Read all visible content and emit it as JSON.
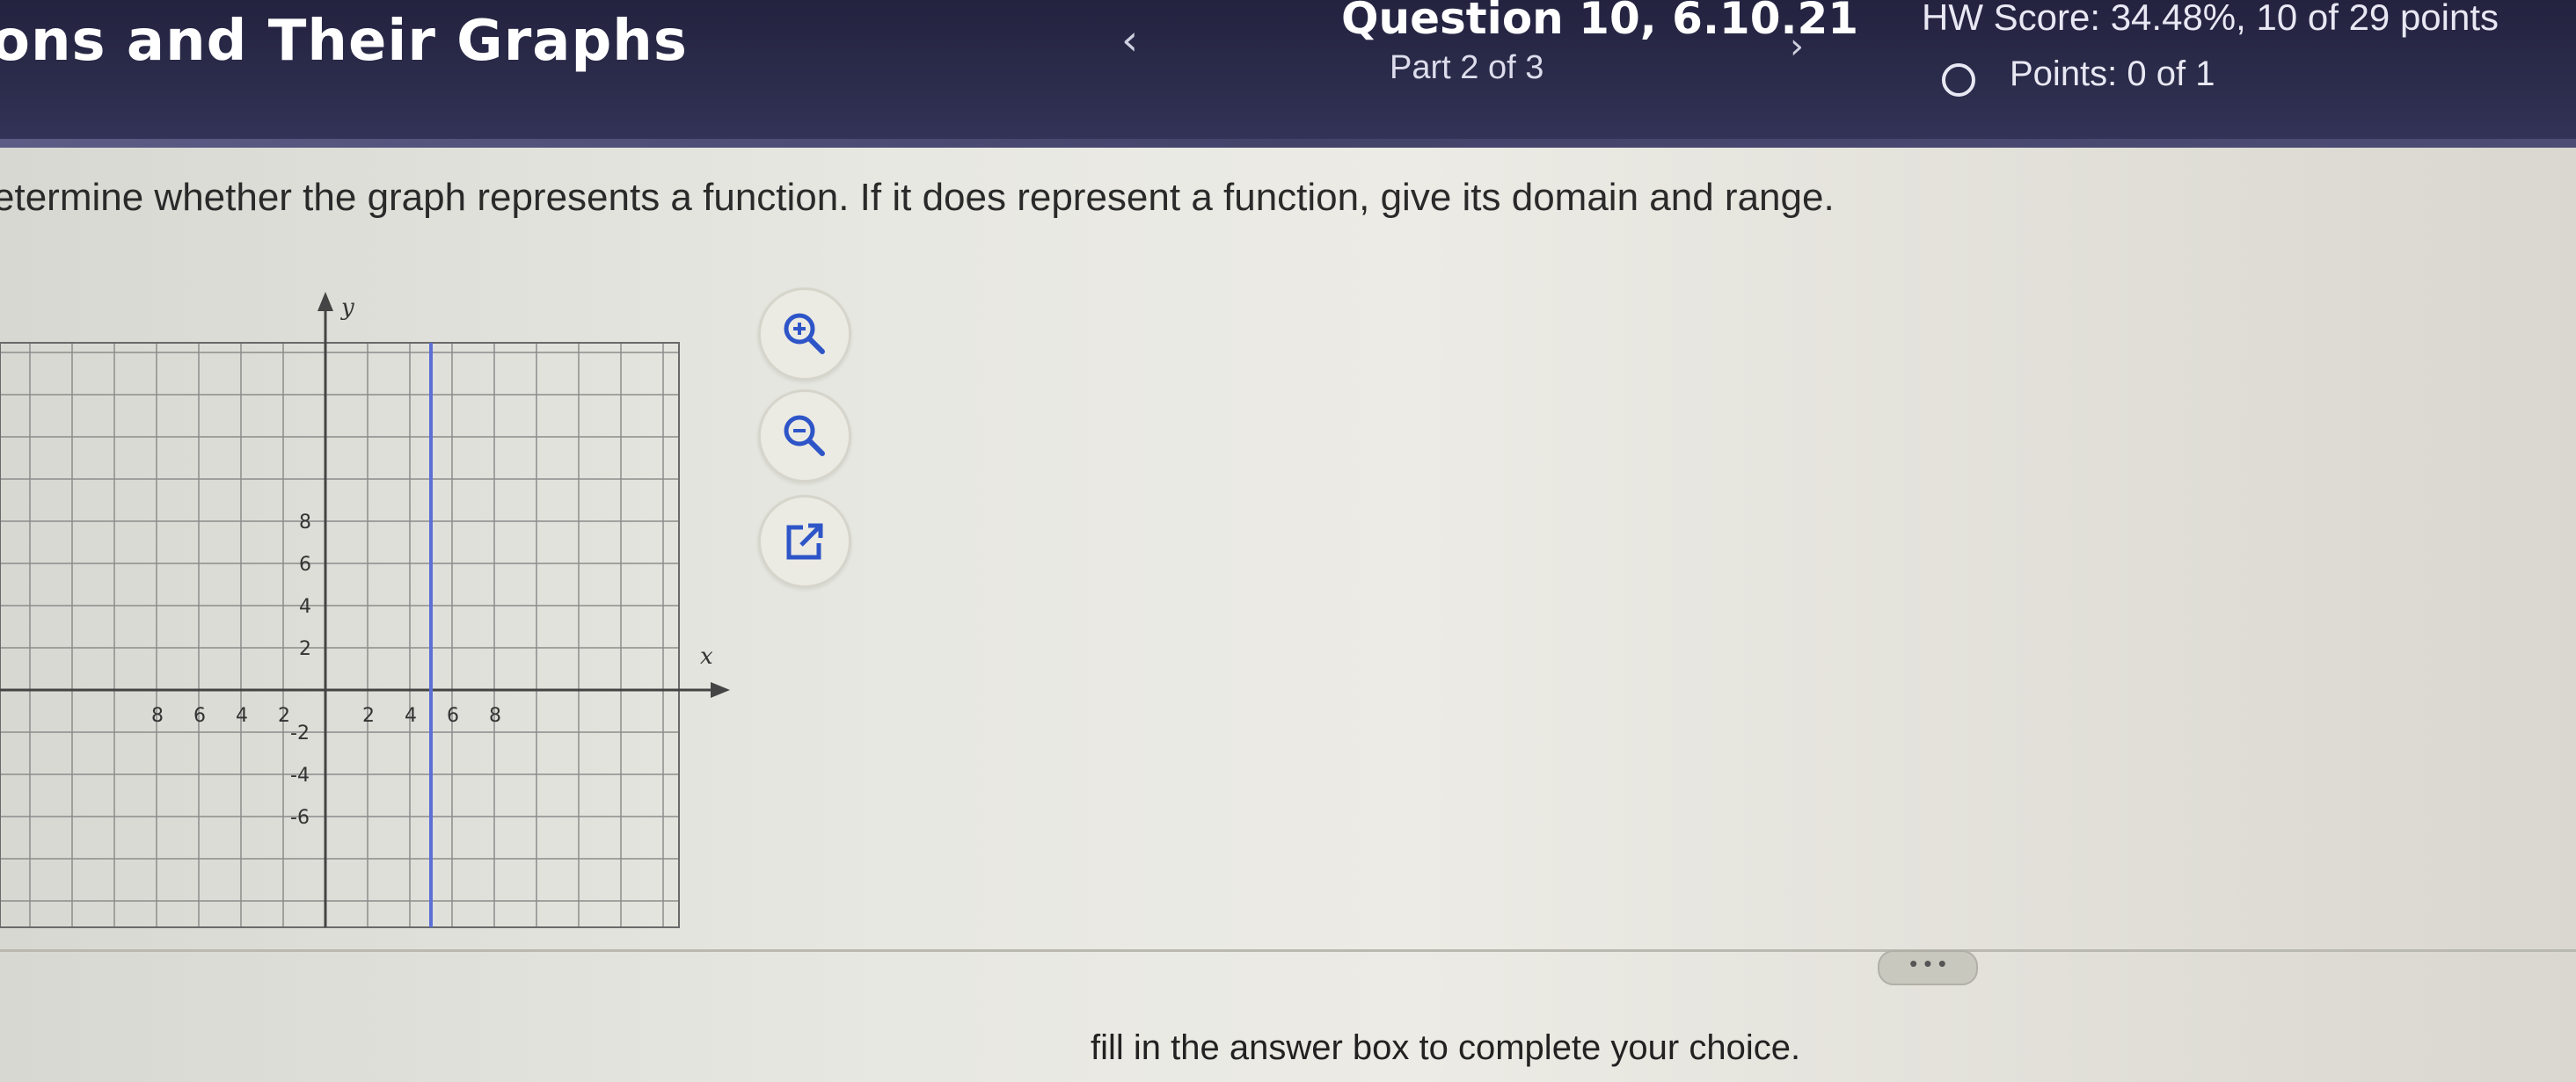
{
  "header": {
    "title": "ons and Their Graphs",
    "question": "Question 10, 6.10.21",
    "part": "Part 2 of 3",
    "hw_score": "HW Score: 34.48%, 10 of 29 points",
    "points": "Points: 0 of 1",
    "prev_glyph": "‹",
    "next_glyph": "›"
  },
  "question": {
    "text": "etermine whether the graph represents a function. If it does represent a function, give its domain and range."
  },
  "graph": {
    "x_axis_label": "x",
    "y_axis_label": "y",
    "x_ticks": [
      "8",
      "6",
      "4",
      "2",
      "2",
      "4",
      "6",
      "8"
    ],
    "y_ticks": [
      "8",
      "6",
      "4",
      "2",
      "-2",
      "-4",
      "-6"
    ],
    "line_color": "#5b6fd6"
  },
  "tools": {
    "zoom_in_icon": "zoom-in-icon",
    "zoom_out_icon": "zoom-out-icon",
    "popout_icon": "external-link-icon"
  },
  "answer": {
    "more_label": "• • •",
    "instruction": "fill in the answer box to complete your choice."
  },
  "colors": {
    "header_bg": "#2c2c4c",
    "accent_blue": "#3a5ad6"
  }
}
